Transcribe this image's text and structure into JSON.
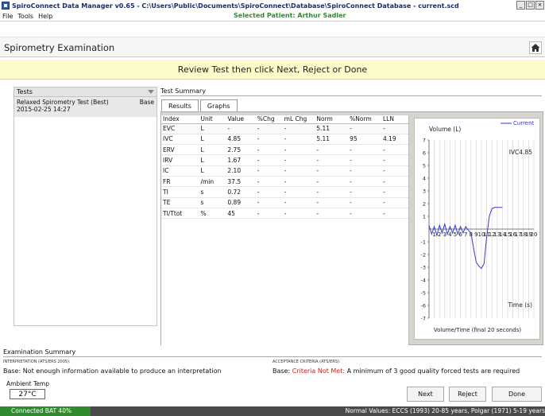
{
  "window": {
    "title": "SpiroConnect Data Manager v0.65 - C:\\Users\\Public\\Documents\\SpiroConnect\\Database\\SpiroConnect Database - current.scd",
    "minimize": "_",
    "maximize": "□",
    "close": "×"
  },
  "menu": {
    "file": "File",
    "tools": "Tools",
    "help": "Help",
    "patient": "Selected Patient: Arthur Sadler"
  },
  "header": {
    "title": "Spirometry Examination",
    "home_icon": "home-icon"
  },
  "banner": {
    "text": "Review Test then click Next, Reject or Done"
  },
  "tests": {
    "header": "Tests",
    "items": [
      {
        "name": "Relaxed Spirometry Test (Best)",
        "date": "2015-02-25 14:27",
        "tag": "Base"
      }
    ]
  },
  "summary": {
    "label": "Test Summary",
    "tabs": [
      "Results",
      "Graphs"
    ],
    "columns": [
      "Index",
      "Unit",
      "Value",
      "%Chg",
      "mL Chg",
      "Norm",
      "%Norm",
      "LLN"
    ],
    "rows": [
      [
        "EVC",
        "L",
        "-",
        "-",
        "-",
        "5.11",
        "-",
        "-"
      ],
      [
        "IVC",
        "L",
        "4.85",
        "-",
        "-",
        "5.11",
        "95",
        "4.19"
      ],
      [
        "ERV",
        "L",
        "2.75",
        "-",
        "-",
        "-",
        "-",
        "-"
      ],
      [
        "IRV",
        "L",
        "1.67",
        "-",
        "-",
        "-",
        "-",
        "-"
      ],
      [
        "IC",
        "L",
        "2.10",
        "-",
        "-",
        "-",
        "-",
        "-"
      ],
      [
        "FR",
        "/min",
        "37.5",
        "-",
        "-",
        "-",
        "-",
        "-"
      ],
      [
        "TI",
        "s",
        "0.72",
        "-",
        "-",
        "-",
        "-",
        "-"
      ],
      [
        "TE",
        "s",
        "0.89",
        "-",
        "-",
        "-",
        "-",
        "-"
      ],
      [
        "TI/Ttot",
        "%",
        "45",
        "-",
        "-",
        "-",
        "-",
        "-"
      ]
    ]
  },
  "chart_data": {
    "type": "line",
    "ylabel": "Volume (L)",
    "xlabel": "Time (s)",
    "caption": "Volume/Time (final 20 seconds)",
    "legend": "Current",
    "annotation": "IVC4.85",
    "ylim": [
      -7,
      7
    ],
    "xlim": [
      0,
      20
    ],
    "yticks": [
      7,
      6,
      5,
      4,
      3,
      2,
      1,
      -1,
      -2,
      -3,
      -4,
      -5,
      -6,
      -7
    ],
    "xticks": [
      1,
      2,
      3,
      4,
      5,
      6,
      7,
      8,
      9,
      10,
      11,
      12,
      13,
      14,
      15,
      16,
      17,
      18,
      19,
      20
    ],
    "series": [
      {
        "name": "Current",
        "x": [
          0,
          0.5,
          1,
          1.5,
          2,
          2.5,
          3,
          3.5,
          4,
          4.5,
          5,
          5.5,
          6,
          6.5,
          7,
          7.5,
          8,
          8.5,
          9,
          9.5,
          10,
          10.5,
          11,
          11.5,
          12,
          12.5,
          13,
          13.5,
          14
        ],
        "y": [
          0.3,
          -0.4,
          0.2,
          -0.5,
          0.3,
          -0.3,
          0.4,
          -0.4,
          0.2,
          -0.3,
          0.3,
          -0.4,
          0.2,
          -0.3,
          0.2,
          -0.1,
          -0.3,
          -1.5,
          -2.6,
          -2.9,
          -3.1,
          -2.7,
          -0.6,
          1.0,
          1.6,
          1.7,
          1.7,
          1.7,
          1.7
        ]
      }
    ],
    "color": "#3a3acc"
  },
  "exam": {
    "label": "Examination Summary",
    "interp_title": "INTERPRETATION (ATS/ERS 2005):",
    "interp_text": "Base: Not enough information available to produce an interpretation",
    "accept_title": "ACCEPTANCE CRITERIA (ATS/ERS):",
    "accept_prefix": "Base: ",
    "accept_crit": "Criteria Not Met:",
    "accept_rest": " A minimum of 3 good quality forced tests are required"
  },
  "ambient": {
    "label": "Ambient Temp",
    "value": "27°C"
  },
  "buttons": {
    "next": "Next",
    "reject": "Reject",
    "done": "Done"
  },
  "status": {
    "battery": "Connected BAT 40%",
    "normals": "Normal Values: ECCS (1993) 20-85 years, Polgar (1971) 5-19 years"
  }
}
